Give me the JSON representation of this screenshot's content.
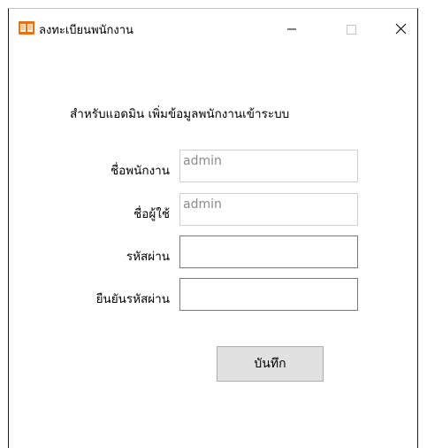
{
  "window": {
    "title": "ลงทะเบียนพนักงาน",
    "app_icon": "open-book-icon",
    "controls": [
      "minimize-icon",
      "maximize-icon",
      "close-icon"
    ]
  },
  "form": {
    "subtitle": "สำหรับแอดมิน เพิ่มข้อมูลพนักงานเข้าระบบ",
    "fields": [
      {
        "label": "ชื่อพนักงาน",
        "value": "admin",
        "enabled": false
      },
      {
        "label": "ชื่อผู้ใช้",
        "value": "admin",
        "enabled": false
      },
      {
        "label": "รหัสผ่าน",
        "value": "",
        "enabled": true
      },
      {
        "label": "ยืนยันรหัสผ่าน",
        "value": "",
        "enabled": true
      }
    ],
    "save_label": "บันทึก"
  },
  "colors": {
    "app_icon": "#e8701a",
    "disabled_text": "#8c8c8c",
    "button_face": "#e1e1e1"
  }
}
